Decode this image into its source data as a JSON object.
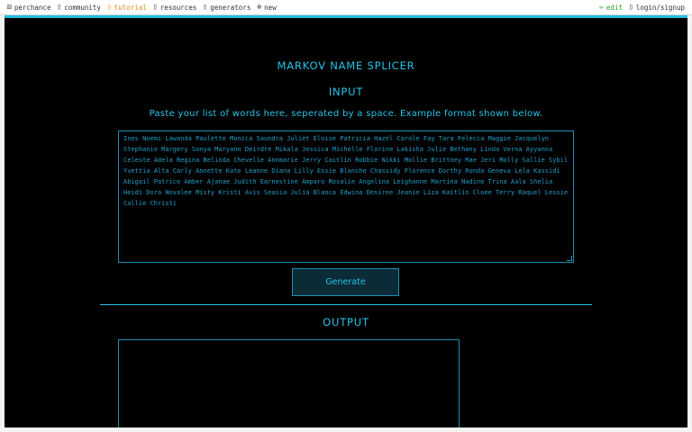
{
  "topbar": {
    "left": [
      {
        "icon": "dice-icon",
        "glyph": "⚄",
        "label": "perchance"
      },
      {
        "icon": "chat-icon",
        "glyph": "▯",
        "label": "community"
      },
      {
        "icon": "book-icon",
        "glyph": "▯",
        "label": "tutorial"
      },
      {
        "icon": "folder-icon",
        "glyph": "▯",
        "label": "resources"
      },
      {
        "icon": "list-icon",
        "glyph": "▯",
        "label": "generators"
      },
      {
        "icon": "plus-circle-icon",
        "glyph": "⊕",
        "label": "new"
      }
    ],
    "right": [
      {
        "icon": "pencil-icon",
        "glyph": "✏",
        "label": "edit"
      },
      {
        "icon": "user-icon",
        "glyph": "▯",
        "label": "login/signup"
      }
    ],
    "colors": {
      "tutorial": "#e08a1e",
      "edit": "#2e9e2e"
    }
  },
  "main": {
    "title": "MARKOV NAME SPLICER",
    "input_heading": "INPUT",
    "description": "Paste your list of words here, seperated by a space. Example format shown below.",
    "input_value": "Ines Noemi Lawanda Paulette Monica Saundra Juliet Eloise Patricia Hazel Carole Fay Tara Felecia Maggie Jacquelyn Stephanie Margery Sonya Maryann Deirdre Mikala Jessica Michelle Florine Lakisha Julie Bethany Linda Verna Ayyanna Celeste Adela Regina Belinda Chevelle Annmarie Jerry Caitlin Robbie Nikki Mollie Brittney Mae Jeri Molly Sallie Sybil Yvettia Alta Carly Annette Kate Leanne Diana Lilly Essie Blanche Chassidy Florence Dorthy Ronda Geneva Lela Kassidi Abigail Patrice Amber Ajanae Judith Earnestine Amparo Rosalie Angelina Leighanne Martina Nadine Trina Aala Shelia Heidi Dora Novalee Misty Kristi Avis Seasia Julia Blanca Edwina Desiree Jeanie Liza Kaitlin Cloee Terry Raquel Lessie Callie Christi",
    "generate_label": "Generate",
    "output_heading": "OUTPUT",
    "output_value": ""
  },
  "colors": {
    "accent": "#27c4e8",
    "background": "#000000",
    "button_bg": "#0b2b37"
  }
}
